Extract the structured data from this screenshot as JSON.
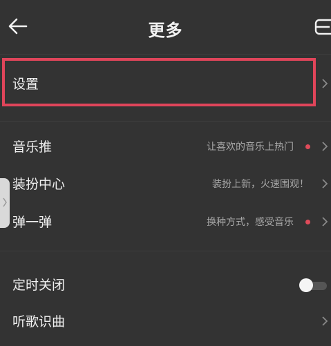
{
  "header": {
    "title": "更多",
    "back_icon": "arrow-left-icon",
    "menu_icon": "menu-icon"
  },
  "items": [
    {
      "label": "设置",
      "subtitle": "",
      "dot": false,
      "control": "chevron"
    },
    {
      "label": "音乐推",
      "subtitle": "让喜欢的音乐上热门",
      "dot": true,
      "control": "chevron"
    },
    {
      "label": "装扮中心",
      "subtitle": "装扮上新，火速围观！",
      "dot": false,
      "control": "chevron"
    },
    {
      "label": "弹一弹",
      "subtitle": "换种方式，感受音乐",
      "dot": true,
      "control": "chevron"
    },
    {
      "label": "定时关闭",
      "subtitle": "",
      "dot": false,
      "control": "toggle",
      "toggle_on": false
    },
    {
      "label": "听歌识曲",
      "subtitle": "",
      "dot": false,
      "control": "chevron"
    }
  ],
  "colors": {
    "background": "#333333",
    "highlight": "#e0455a",
    "dot": "#e04b5a",
    "text": "#f0f0f0",
    "subtext": "#a8a8a8"
  }
}
